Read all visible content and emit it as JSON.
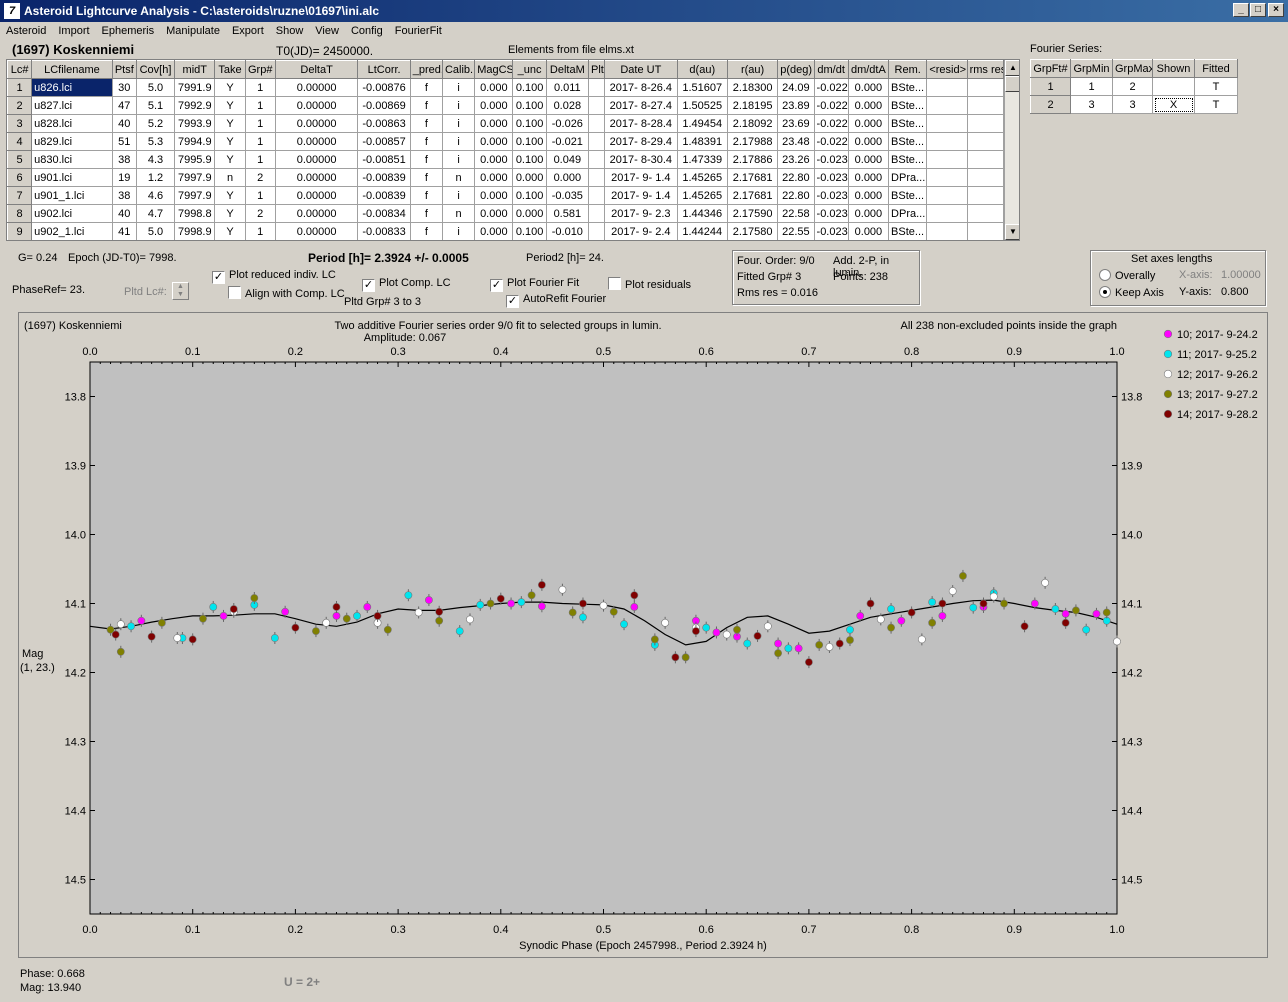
{
  "window": {
    "title": "Asteroid Lightcurve Analysis - C:\\asteroids\\ruzne\\01697\\ini.alc",
    "app_icon": "7"
  },
  "menu": [
    "Asteroid",
    "Import",
    "Ephemeris",
    "Manipulate",
    "Export",
    "Show",
    "View",
    "Config",
    "FourierFit"
  ],
  "header": {
    "asteroid": "(1697) Koskenniemi",
    "t0": "T0(JD)= 2450000.",
    "elements": "Elements from file elms.xt",
    "fourier_label": "Fourier Series:"
  },
  "lc_table": {
    "columns": [
      "Lc#",
      "LCfilename",
      "Ptsf",
      "Cov[h]",
      "midT",
      "Take",
      "Grp#",
      "DeltaT",
      "LtCorr.",
      "_pred.",
      "Calib.",
      "MagCS",
      "_unc",
      "DeltaM",
      "Plt",
      "Date UT",
      "d(au)",
      "r(au)",
      "p(deg)",
      "dm/dt",
      "dm/dtA",
      "Rem.",
      "<resid>",
      "rms res"
    ],
    "rows": [
      [
        "1",
        "u826.lci",
        "30",
        "5.0",
        "7991.9",
        "Y",
        "1",
        "0.00000",
        "-0.00876",
        "f",
        "i",
        "0.000",
        "0.100",
        "0.011",
        "",
        "2017- 8-26.4",
        "1.51607",
        "2.18300",
        "24.09",
        "-0.022",
        "0.000",
        "BSte...",
        "",
        ""
      ],
      [
        "2",
        "u827.lci",
        "47",
        "5.1",
        "7992.9",
        "Y",
        "1",
        "0.00000",
        "-0.00869",
        "f",
        "i",
        "0.000",
        "0.100",
        "0.028",
        "",
        "2017- 8-27.4",
        "1.50525",
        "2.18195",
        "23.89",
        "-0.022",
        "0.000",
        "BSte...",
        "",
        ""
      ],
      [
        "3",
        "u828.lci",
        "40",
        "5.2",
        "7993.9",
        "Y",
        "1",
        "0.00000",
        "-0.00863",
        "f",
        "i",
        "0.000",
        "0.100",
        "-0.026",
        "",
        "2017- 8-28.4",
        "1.49454",
        "2.18092",
        "23.69",
        "-0.022",
        "0.000",
        "BSte...",
        "",
        ""
      ],
      [
        "4",
        "u829.lci",
        "51",
        "5.3",
        "7994.9",
        "Y",
        "1",
        "0.00000",
        "-0.00857",
        "f",
        "i",
        "0.000",
        "0.100",
        "-0.021",
        "",
        "2017- 8-29.4",
        "1.48391",
        "2.17988",
        "23.48",
        "-0.022",
        "0.000",
        "BSte...",
        "",
        ""
      ],
      [
        "5",
        "u830.lci",
        "38",
        "4.3",
        "7995.9",
        "Y",
        "1",
        "0.00000",
        "-0.00851",
        "f",
        "i",
        "0.000",
        "0.100",
        "0.049",
        "",
        "2017- 8-30.4",
        "1.47339",
        "2.17886",
        "23.26",
        "-0.023",
        "0.000",
        "BSte...",
        "",
        ""
      ],
      [
        "6",
        "u901.lci",
        "19",
        "1.2",
        "7997.9",
        "n",
        "2",
        "0.00000",
        "-0.00839",
        "f",
        "n",
        "0.000",
        "0.000",
        "0.000",
        "",
        "2017- 9- 1.4",
        "1.45265",
        "2.17681",
        "22.80",
        "-0.023",
        "0.000",
        "DPra...",
        "",
        ""
      ],
      [
        "7",
        "u901_1.lci",
        "38",
        "4.6",
        "7997.9",
        "Y",
        "1",
        "0.00000",
        "-0.00839",
        "f",
        "i",
        "0.000",
        "0.100",
        "-0.035",
        "",
        "2017- 9- 1.4",
        "1.45265",
        "2.17681",
        "22.80",
        "-0.023",
        "0.000",
        "BSte...",
        "",
        ""
      ],
      [
        "8",
        "u902.lci",
        "40",
        "4.7",
        "7998.8",
        "Y",
        "2",
        "0.00000",
        "-0.00834",
        "f",
        "n",
        "0.000",
        "0.000",
        "0.581",
        "",
        "2017- 9- 2.3",
        "1.44346",
        "2.17590",
        "22.58",
        "-0.023",
        "0.000",
        "DPra...",
        "",
        ""
      ],
      [
        "9",
        "u902_1.lci",
        "41",
        "5.0",
        "7998.9",
        "Y",
        "1",
        "0.00000",
        "-0.00833",
        "f",
        "i",
        "0.000",
        "0.100",
        "-0.010",
        "",
        "2017- 9- 2.4",
        "1.44244",
        "2.17580",
        "22.55",
        "-0.023",
        "0.000",
        "BSte...",
        "",
        ""
      ]
    ]
  },
  "fourier_table": {
    "columns": [
      "GrpFt#",
      "GrpMin",
      "GrpMax",
      "Shown",
      "Fitted"
    ],
    "rows": [
      [
        "1",
        "1",
        "2",
        "",
        "T"
      ],
      [
        "2",
        "3",
        "3",
        "X",
        "T"
      ]
    ]
  },
  "controls": {
    "g": "G= 0.24",
    "epoch": "Epoch (JD-T0)= 7998.",
    "period": "Period [h]= 2.3924 +/- 0.0005",
    "period2": "Period2 [h]= 24.",
    "phaseref": "PhaseRef= 23.",
    "pltd_lc": "Pltd Lc#:",
    "plot_reduced": "Plot reduced indiv. LC",
    "align_comp": "Align with Comp. LC",
    "plot_comp": "Plot Comp. LC",
    "pltd_grp": "Pltd Grp#  3  to  3",
    "plot_fourier": "Plot Fourier Fit",
    "autorefit": "AutoRefit Fourier",
    "plot_residuals": "Plot residuals",
    "four_order": "Four. Order:  9/0",
    "add_2p": "Add. 2-P, in lumin.",
    "fitted_grp": "Fitted Grp# 3",
    "points": "Points: 238",
    "rms": "Rms res     = 0.016",
    "axes_title": "Set axes lengths",
    "overally": "Overally",
    "keep_axis": "Keep Axis",
    "x_axis_label": "X-axis:",
    "x_axis_value": "1.00000",
    "y_axis_label": "Y-axis:",
    "y_axis_value": "0.800"
  },
  "plot": {
    "name": "(1697) Koskenniemi",
    "title": "Two additive Fourier series order 9/0 fit to selected groups in lumin.",
    "amplitude": "Amplitude: 0.067",
    "note": "All 238 non-excluded points inside the graph",
    "ylabel": "Mag",
    "ylabel2": "(1, 23.)",
    "xlabel": "Synodic Phase (Epoch 2457998., Period 2.3924 h)"
  },
  "chart_data": {
    "type": "scatter",
    "title": "Two additive Fourier series order 9/0 fit to selected groups in lumin.",
    "xlabel": "Synodic Phase (Epoch 2457998., Period 2.3924 h)",
    "ylabel": "Mag",
    "xlim": [
      0.0,
      1.0
    ],
    "ylim": [
      14.55,
      13.75
    ],
    "x_ticks": [
      "0.0",
      "0.1",
      "0.2",
      "0.3",
      "0.4",
      "0.5",
      "0.6",
      "0.7",
      "0.8",
      "0.9",
      "1.0"
    ],
    "y_ticks": [
      "13.8",
      "13.9",
      "14.0",
      "14.1",
      "14.2",
      "14.3",
      "14.4",
      "14.5"
    ],
    "legend_position": "right",
    "series": [
      {
        "name": "10; 2017- 9-24.2",
        "color": "#ff00ff",
        "x": [
          0.05,
          0.13,
          0.19,
          0.27,
          0.33,
          0.41,
          0.44,
          0.53,
          0.59,
          0.63,
          0.67,
          0.75,
          0.79,
          0.83,
          0.87,
          0.92,
          0.95,
          0.98,
          0.24,
          0.69,
          0.61
        ],
        "y": [
          14.125,
          14.118,
          14.112,
          14.105,
          14.095,
          14.1,
          14.104,
          14.105,
          14.125,
          14.148,
          14.158,
          14.118,
          14.125,
          14.118,
          14.105,
          14.1,
          14.115,
          14.115,
          14.118,
          14.165,
          14.142
        ]
      },
      {
        "name": "11; 2017- 9-25.2",
        "color": "#00e5ee",
        "x": [
          0.04,
          0.09,
          0.12,
          0.16,
          0.18,
          0.26,
          0.31,
          0.36,
          0.38,
          0.42,
          0.48,
          0.52,
          0.55,
          0.6,
          0.64,
          0.68,
          0.74,
          0.78,
          0.82,
          0.86,
          0.88,
          0.94,
          0.97,
          0.99
        ],
        "y": [
          14.133,
          14.15,
          14.105,
          14.102,
          14.15,
          14.118,
          14.088,
          14.14,
          14.102,
          14.098,
          14.12,
          14.13,
          14.16,
          14.135,
          14.158,
          14.165,
          14.138,
          14.108,
          14.098,
          14.106,
          14.085,
          14.108,
          14.138,
          14.125
        ]
      },
      {
        "name": "12; 2017- 9-26.2",
        "color": "#ffffff",
        "x": [
          0.03,
          0.085,
          0.14,
          0.23,
          0.28,
          0.32,
          0.37,
          0.46,
          0.5,
          0.56,
          0.59,
          0.62,
          0.66,
          0.72,
          0.77,
          0.81,
          0.84,
          0.88,
          0.93,
          1.0
        ],
        "y": [
          14.13,
          14.15,
          14.112,
          14.128,
          14.128,
          14.113,
          14.123,
          14.08,
          14.103,
          14.128,
          14.135,
          14.145,
          14.133,
          14.163,
          14.123,
          14.152,
          14.082,
          14.09,
          14.07,
          14.155
        ]
      },
      {
        "name": "13; 2017- 9-27.2",
        "color": "#808000",
        "x": [
          0.02,
          0.03,
          0.07,
          0.11,
          0.16,
          0.22,
          0.25,
          0.29,
          0.34,
          0.39,
          0.43,
          0.47,
          0.51,
          0.55,
          0.58,
          0.63,
          0.67,
          0.71,
          0.74,
          0.78,
          0.82,
          0.85,
          0.89,
          0.96,
          0.99
        ],
        "y": [
          14.138,
          14.17,
          14.128,
          14.122,
          14.092,
          14.14,
          14.122,
          14.138,
          14.125,
          14.1,
          14.088,
          14.113,
          14.112,
          14.152,
          14.178,
          14.138,
          14.172,
          14.16,
          14.153,
          14.135,
          14.128,
          14.06,
          14.1,
          14.11,
          14.113
        ]
      },
      {
        "name": "14; 2017- 9-28.2",
        "color": "#800000",
        "x": [
          0.025,
          0.06,
          0.1,
          0.14,
          0.2,
          0.24,
          0.28,
          0.34,
          0.4,
          0.44,
          0.48,
          0.53,
          0.57,
          0.59,
          0.65,
          0.7,
          0.73,
          0.76,
          0.8,
          0.83,
          0.87,
          0.91,
          0.95
        ],
        "y": [
          14.145,
          14.148,
          14.152,
          14.108,
          14.135,
          14.105,
          14.118,
          14.112,
          14.093,
          14.073,
          14.1,
          14.088,
          14.178,
          14.14,
          14.147,
          14.185,
          14.158,
          14.1,
          14.113,
          14.1,
          14.1,
          14.133,
          14.128
        ]
      }
    ],
    "fit_curve": {
      "x": [
        0.0,
        0.02,
        0.04,
        0.06,
        0.08,
        0.1,
        0.12,
        0.14,
        0.16,
        0.18,
        0.2,
        0.22,
        0.24,
        0.26,
        0.28,
        0.3,
        0.32,
        0.34,
        0.36,
        0.38,
        0.4,
        0.42,
        0.44,
        0.46,
        0.48,
        0.5,
        0.52,
        0.54,
        0.56,
        0.58,
        0.6,
        0.62,
        0.64,
        0.66,
        0.68,
        0.7,
        0.72,
        0.74,
        0.76,
        0.78,
        0.8,
        0.82,
        0.84,
        0.86,
        0.88,
        0.9,
        0.92,
        0.94,
        0.96,
        0.98,
        1.0
      ],
      "y": [
        14.133,
        14.137,
        14.133,
        14.127,
        14.122,
        14.118,
        14.118,
        14.117,
        14.115,
        14.115,
        14.122,
        14.13,
        14.133,
        14.127,
        14.115,
        14.108,
        14.11,
        14.11,
        14.106,
        14.103,
        14.1,
        14.098,
        14.098,
        14.1,
        14.101,
        14.102,
        14.108,
        14.125,
        14.145,
        14.16,
        14.155,
        14.135,
        14.12,
        14.118,
        14.13,
        14.143,
        14.14,
        14.13,
        14.12,
        14.115,
        14.11,
        14.105,
        14.1,
        14.096,
        14.095,
        14.1,
        14.106,
        14.11,
        14.113,
        14.12,
        14.13
      ]
    }
  },
  "status": {
    "phase": "Phase:  0.668",
    "mag": "Mag:    13.940",
    "u": "U = 2+"
  }
}
